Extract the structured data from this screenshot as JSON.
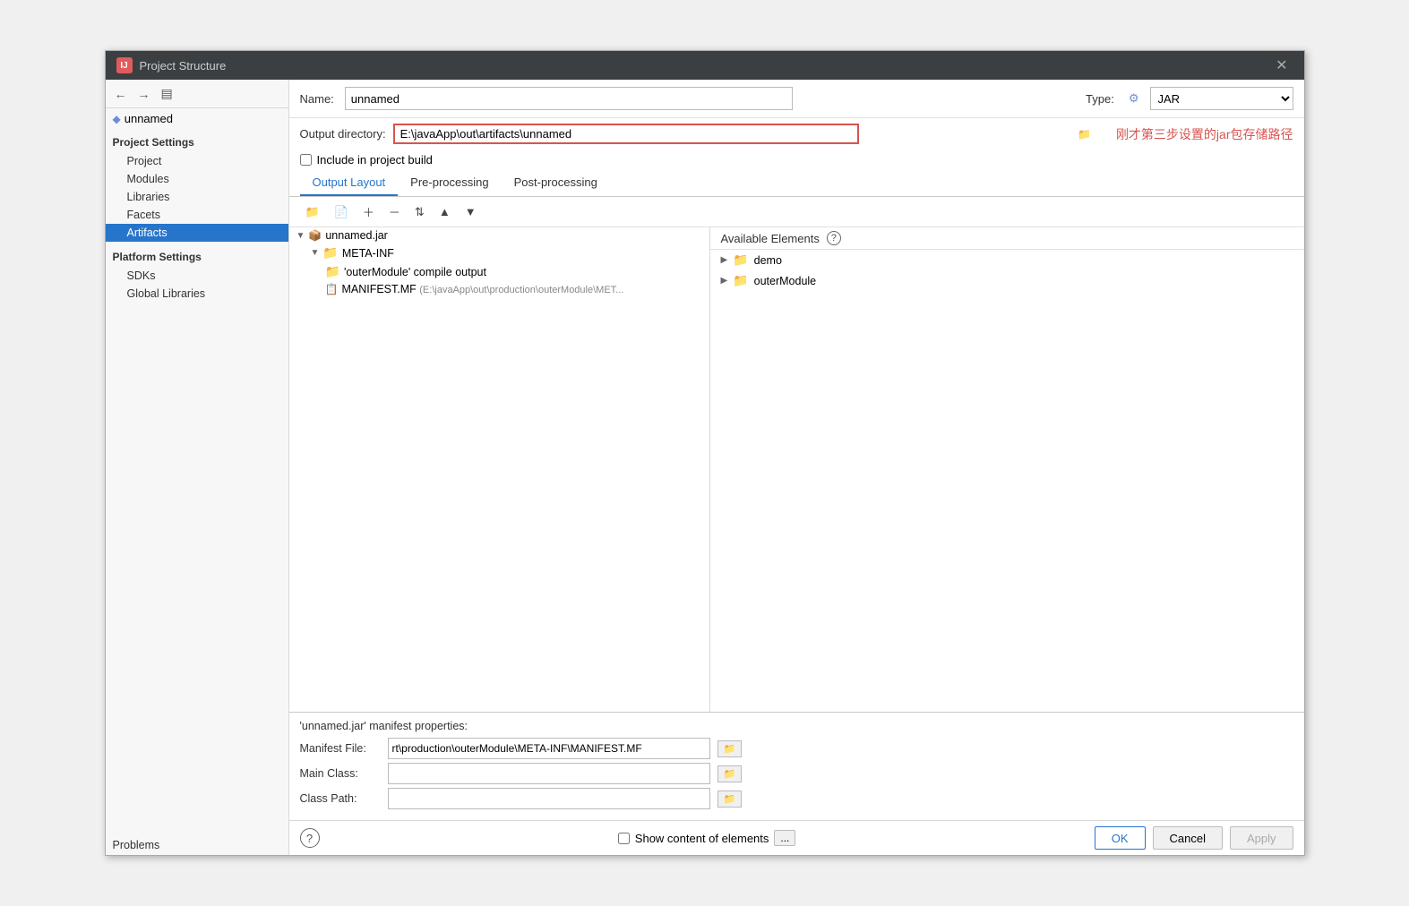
{
  "window": {
    "title": "Project Structure",
    "logo": "IJ"
  },
  "sidebar": {
    "nav_back": "←",
    "nav_forward": "→",
    "tree_item": "unnamed",
    "project_settings_header": "Project Settings",
    "project_settings_items": [
      "Project",
      "Modules",
      "Libraries",
      "Facets",
      "Artifacts"
    ],
    "platform_settings_header": "Platform Settings",
    "platform_settings_items": [
      "SDKs",
      "Global Libraries"
    ],
    "problems_label": "Problems",
    "active_item": "Artifacts"
  },
  "main": {
    "name_label": "Name:",
    "name_value": "unnamed",
    "type_label": "Type:",
    "type_value": "JAR",
    "type_icon": "⚙",
    "output_dir_label": "Output directory:",
    "output_dir_value": "E:\\javaApp\\out\\artifacts\\unnamed",
    "annotation_text": "刚才第三步设置的jar包存储路径",
    "include_label": "Include in project build",
    "tabs": [
      "Output Layout",
      "Pre-processing",
      "Post-processing"
    ],
    "active_tab": "Output Layout",
    "toolbar_icons": [
      "folder-add",
      "folder",
      "add",
      "remove",
      "sort",
      "up",
      "down"
    ],
    "available_elements_label": "Available Elements",
    "tree_items": [
      {
        "id": "unnamed-jar",
        "label": "unnamed.jar",
        "indent": 0,
        "type": "jar",
        "expanded": true
      },
      {
        "id": "meta-inf",
        "label": "META-INF",
        "indent": 1,
        "type": "folder",
        "expanded": true
      },
      {
        "id": "outer-module-output",
        "label": "'outerModule' compile output",
        "indent": 2,
        "type": "folder"
      },
      {
        "id": "manifest-mf",
        "label": "MANIFEST.MF",
        "indent": 2,
        "type": "manifest",
        "path": "(E:\\javaApp\\out\\production\\outerModule\\MET..."
      }
    ],
    "available_items": [
      {
        "id": "demo",
        "label": "demo",
        "arrow": true
      },
      {
        "id": "outer-module",
        "label": "outerModule",
        "arrow": true
      }
    ],
    "manifest_properties_title": "'unnamed.jar' manifest properties:",
    "manifest_file_label": "Manifest File:",
    "manifest_file_value": "rt\\production\\outerModule\\META-INF\\MANIFEST.MF",
    "main_class_label": "Main Class:",
    "main_class_value": "",
    "class_path_label": "Class Path:",
    "class_path_value": "",
    "show_content_label": "Show content of elements",
    "dotdotdot": "...",
    "ok_btn": "OK",
    "cancel_btn": "Cancel",
    "apply_btn": "Apply",
    "help_icon": "?"
  }
}
